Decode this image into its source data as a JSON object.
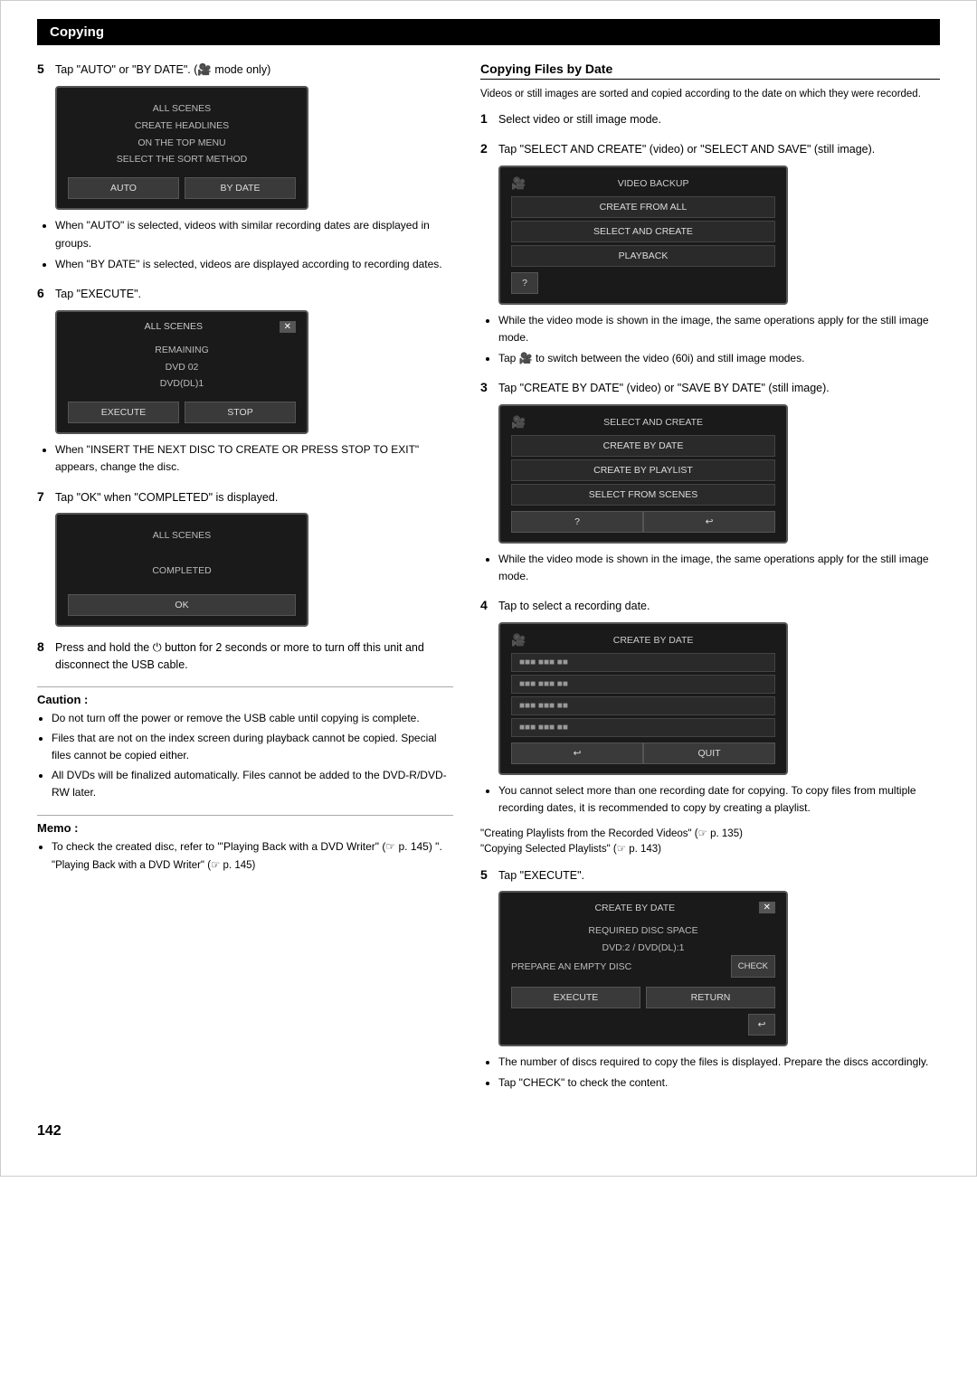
{
  "header": {
    "title": "Copying"
  },
  "page_number": "142",
  "left_col": {
    "step5": {
      "num": "5",
      "text": "Tap \"AUTO\" or \"BY DATE\". (🎥 mode only)",
      "screen1": {
        "title_line1": "ALL SCENES",
        "title_line2": "CREATE HEADLINES",
        "title_line3": "ON THE TOP MENU",
        "title_line4": "SELECT THE SORT METHOD",
        "btn_auto": "AUTO",
        "btn_bydate": "BY DATE"
      },
      "bullets": [
        "When \"AUTO\" is selected, videos with similar recording dates are displayed in groups.",
        "When \"BY DATE\" is selected, videos are displayed according to recording dates."
      ]
    },
    "step6": {
      "num": "6",
      "text": "Tap \"EXECUTE\".",
      "screen2": {
        "title": "ALL SCENES",
        "line1": "REMAINING",
        "line2": "DVD  02",
        "line3": "DVD(DL)1",
        "btn_execute": "EXECUTE",
        "btn_stop": "STOP"
      },
      "bullets": [
        "When \"INSERT THE NEXT DISC TO CREATE OR PRESS STOP TO EXIT\" appears, change the disc."
      ]
    },
    "step7": {
      "num": "7",
      "text": "Tap \"OK\" when \"COMPLETED\" is displayed.",
      "screen3": {
        "title": "ALL SCENES",
        "completed": "COMPLETED",
        "btn_ok": "OK"
      }
    },
    "step8": {
      "num": "8",
      "text": "Press and hold the ⏻ button for 2 seconds or more to turn off this unit and disconnect the USB cable."
    },
    "caution": {
      "title": "Caution :",
      "items": [
        "Do not turn off the power or remove the USB cable until copying is complete.",
        "Files that are not on the index screen during playback cannot be copied. Special files cannot be copied either.",
        "All DVDs will be finalized automatically. Files cannot be added to the DVD-R/DVD-RW later."
      ]
    },
    "memo": {
      "title": "Memo :",
      "items": [
        "To check the created disc, refer to \"'Playing Back with a DVD Writer\" (☞ p. 145) \"."
      ],
      "link": "\"Playing Back with a DVD Writer\" (☞ p. 145)"
    }
  },
  "right_col": {
    "section_title": "Copying Files by Date",
    "intro": "Videos or still images are sorted and copied according to the date on which they were recorded.",
    "step1": {
      "num": "1",
      "text": "Select video or still image mode."
    },
    "step2": {
      "num": "2",
      "text": "Tap \"SELECT AND CREATE\" (video) or \"SELECT AND SAVE\" (still image).",
      "screen": {
        "cam_icon": "🎥",
        "title": "VIDEO BACKUP",
        "menu_items": [
          "CREATE FROM ALL",
          "SELECT AND CREATE",
          "PLAYBACK"
        ],
        "question_btn": "?"
      }
    },
    "step2_bullets": [
      "While the video mode is shown in the image, the same operations apply for the still image mode.",
      "Tap 🎥 to switch between the video (60i) and still image modes."
    ],
    "step3": {
      "num": "3",
      "text": "Tap \"CREATE BY DATE\" (video) or \"SAVE BY DATE\" (still image).",
      "screen": {
        "cam_icon": "🎥",
        "title": "SELECT AND CREATE",
        "menu_items": [
          "CREATE BY DATE",
          "CREATE BY PLAYLIST",
          "SELECT FROM SCENES"
        ],
        "question_btn": "?",
        "back_btn": "↩"
      }
    },
    "step3_bullets": [
      "While the video mode is shown in the image, the same operations apply for the still image mode."
    ],
    "step4": {
      "num": "4",
      "text": "Tap to select a recording date.",
      "screen": {
        "cam_icon": "🎥",
        "title": "CREATE BY DATE",
        "dates": [
          "■■■ ■■■ ■■",
          "■■■ ■■■ ■■",
          "■■■ ■■■ ■■",
          "■■■ ■■■ ■■"
        ],
        "back_btn": "↩",
        "quit_btn": "QUIT"
      }
    },
    "step4_note": "You cannot select more than one recording date for copying. To copy files from multiple recording dates, it is recommended to copy by creating a playlist.",
    "step4_links": [
      "\"Creating Playlists from the Recorded Videos\" (☞ p. 135)",
      "\"Copying Selected Playlists\" (☞ p. 143)"
    ],
    "step5": {
      "num": "5",
      "text": "Tap \"EXECUTE\".",
      "screen": {
        "title": "CREATE BY DATE",
        "close_btn": "✕",
        "line1": "REQUIRED DISC SPACE",
        "line2": "DVD:2 / DVD(DL):1",
        "line3": "PREPARE AN EMPTY DISC",
        "check_btn": "CHECK",
        "btn_execute": "EXECUTE",
        "btn_return": "RETURN",
        "back_btn": "↩"
      }
    },
    "step5_bullets": [
      "The number of discs required to copy the files is displayed. Prepare the discs accordingly.",
      "Tap \"CHECK\" to check the content."
    ]
  }
}
